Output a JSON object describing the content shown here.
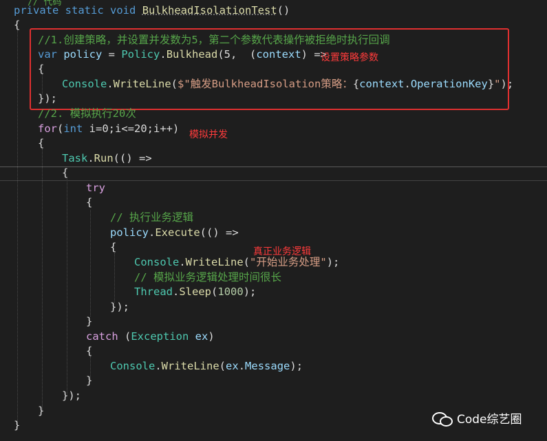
{
  "header_fragment": "// 代码",
  "lines": {
    "l1": {
      "kw1": "private",
      "kw2": "static",
      "kw3": "void",
      "method": "BulkheadIsolationTest",
      "punct": "()"
    },
    "l2": "{",
    "l3": "//1.创建策略，并设置并发数为5，第二个参数代表操作被拒绝时执行回调",
    "l4": {
      "kw": "var",
      "name": "policy",
      "eq": " = ",
      "type": "Policy",
      "dot": ".",
      "method": "Bulkhead",
      "args": "(5,  (",
      "param": "context",
      "tail": ") =>"
    },
    "l5": "{",
    "l6": {
      "type": "Console",
      "dot": ".",
      "method": "WriteLine",
      "open": "(",
      "str1": "$\"触发BulkheadIsolation策略：",
      "brace_open": "{",
      "param": "context",
      "dot2": ".",
      "prop": "OperationKey",
      "brace_close": "}",
      "str2": "\"",
      "close": ");"
    },
    "l7": "});",
    "l8": "//2. 模拟执行20次",
    "l9": {
      "kw": "for",
      "open": "(",
      "type": "int",
      "rest": " i=0;i<=20;i++)"
    },
    "l10": "{",
    "l11": {
      "type": "Task",
      "dot": ".",
      "method": "Run",
      "rest": "(() =>"
    },
    "l12": "{",
    "l13": "try",
    "l14": "{",
    "l15": "// 执行业务逻辑",
    "l16": {
      "name": "policy",
      "dot": ".",
      "method": "Execute",
      "rest": "(() =>"
    },
    "l17": "{",
    "l18": {
      "type": "Console",
      "dot": ".",
      "method": "WriteLine",
      "open": "(",
      "str": "\"开始业务处理\"",
      "close": ");"
    },
    "l19": "// 模拟业务逻辑处理时间很长",
    "l20": {
      "type": "Thread",
      "dot": ".",
      "method": "Sleep",
      "open": "(",
      "num": "1000",
      "close": ");"
    },
    "l21": "});",
    "l22": "}",
    "l23": {
      "kw": "catch",
      "open": " (",
      "type": "Exception",
      "name": " ex",
      "close": ")"
    },
    "l24": "{",
    "l25": {
      "type": "Console",
      "dot": ".",
      "method": "WriteLine",
      "open": "(",
      "name": "ex",
      "dot2": ".",
      "prop": "Message",
      "close": ");"
    },
    "l26": "}",
    "l27": "});",
    "l28": "}",
    "l29": "}"
  },
  "annotations": {
    "policy_params": "设置策略参数",
    "simulate_concurrency": "模拟并发",
    "real_business_logic": "真正业务逻辑"
  },
  "watermark": {
    "icon": "wechat-icon",
    "text": "Code综艺圈"
  },
  "colors": {
    "background": "#1e1e1e",
    "keyword": "#569cd6",
    "comment": "#57a64a",
    "type": "#4ec9b0",
    "method": "#dcdcaa",
    "string": "#d69d85",
    "annotation": "#ff3b3b"
  }
}
